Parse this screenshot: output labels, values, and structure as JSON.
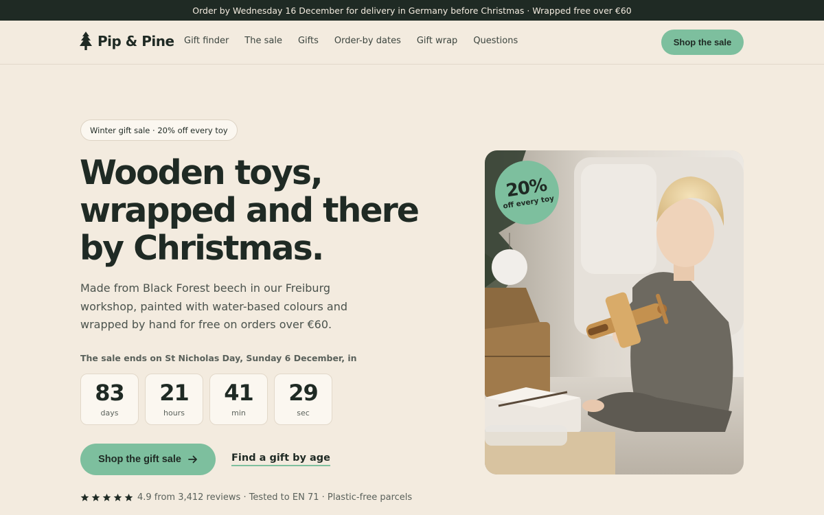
{
  "announcement": "Order by Wednesday 16 December for delivery in Germany before Christmas · Wrapped free over €60",
  "brand": {
    "name": "Pip & Pine",
    "logo_icon": "pine-tree-icon"
  },
  "nav": {
    "links": [
      {
        "label": "Gift finder"
      },
      {
        "label": "The sale"
      },
      {
        "label": "Gifts"
      },
      {
        "label": "Order-by dates"
      },
      {
        "label": "Gift wrap"
      },
      {
        "label": "Questions"
      }
    ],
    "cta": "Shop the sale"
  },
  "hero": {
    "pill": "Winter gift sale · 20% off every toy",
    "headline": [
      "Wooden toys,",
      "wrapped and there",
      "by Christmas."
    ],
    "lede": "Made from Black Forest beech in our Freiburg workshop, painted with water-based colours and wrapped by hand for free on orders over €60.",
    "sale_ends": "The sale ends on St Nicholas Day, Sunday 6 December, in",
    "countdown": [
      {
        "value": "83",
        "unit": "days"
      },
      {
        "value": "21",
        "unit": "hours"
      },
      {
        "value": "41",
        "unit": "min"
      },
      {
        "value": "29",
        "unit": "sec"
      }
    ],
    "primary_cta": "Shop the gift sale",
    "secondary_cta": "Find a gift by age",
    "rating": {
      "stars": 5,
      "text": "4.9 from 3,412 reviews · Tested to EN 71 · Plastic-free parcels"
    },
    "badge": {
      "big": "20%",
      "small": "off every toy"
    }
  },
  "colors": {
    "background": "#f3ebdf",
    "ink": "#1f2a24",
    "accent": "#7dbf9e",
    "announcement_bg": "#1f2a24"
  }
}
